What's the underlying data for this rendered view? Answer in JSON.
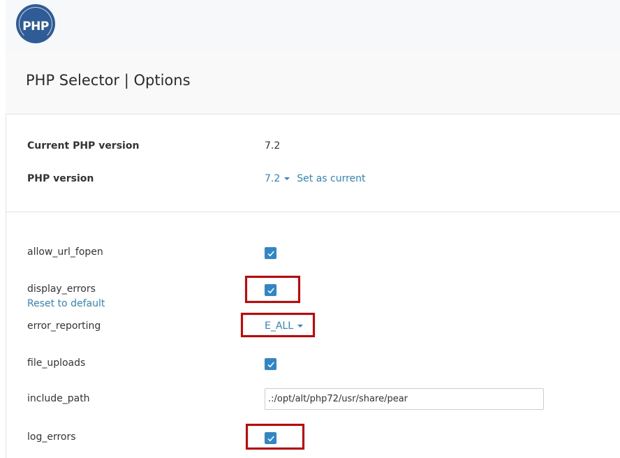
{
  "logo": {
    "text": "PHP"
  },
  "page": {
    "title": "PHP Selector | Options"
  },
  "version_info": {
    "current_label": "Current PHP version",
    "current_value": "7.2",
    "version_label": "PHP version",
    "version_value": "7.2",
    "set_current_label": "Set as current"
  },
  "options": {
    "allow_url_fopen": {
      "label": "allow_url_fopen",
      "checked": true
    },
    "display_errors": {
      "label": "display_errors",
      "checked": true,
      "reset_label": "Reset to default"
    },
    "error_reporting": {
      "label": "error_reporting",
      "value": "E_ALL"
    },
    "file_uploads": {
      "label": "file_uploads",
      "checked": true
    },
    "include_path": {
      "label": "include_path",
      "value": ".:/opt/alt/php72/usr/share/pear"
    },
    "log_errors": {
      "label": "log_errors",
      "checked": true
    }
  },
  "colors": {
    "accent": "#2f86c8",
    "highlight": "#d40000",
    "logo_bg": "#2f5b96"
  },
  "icons": [
    "php-logo-icon",
    "check-icon",
    "caret-down-icon"
  ]
}
